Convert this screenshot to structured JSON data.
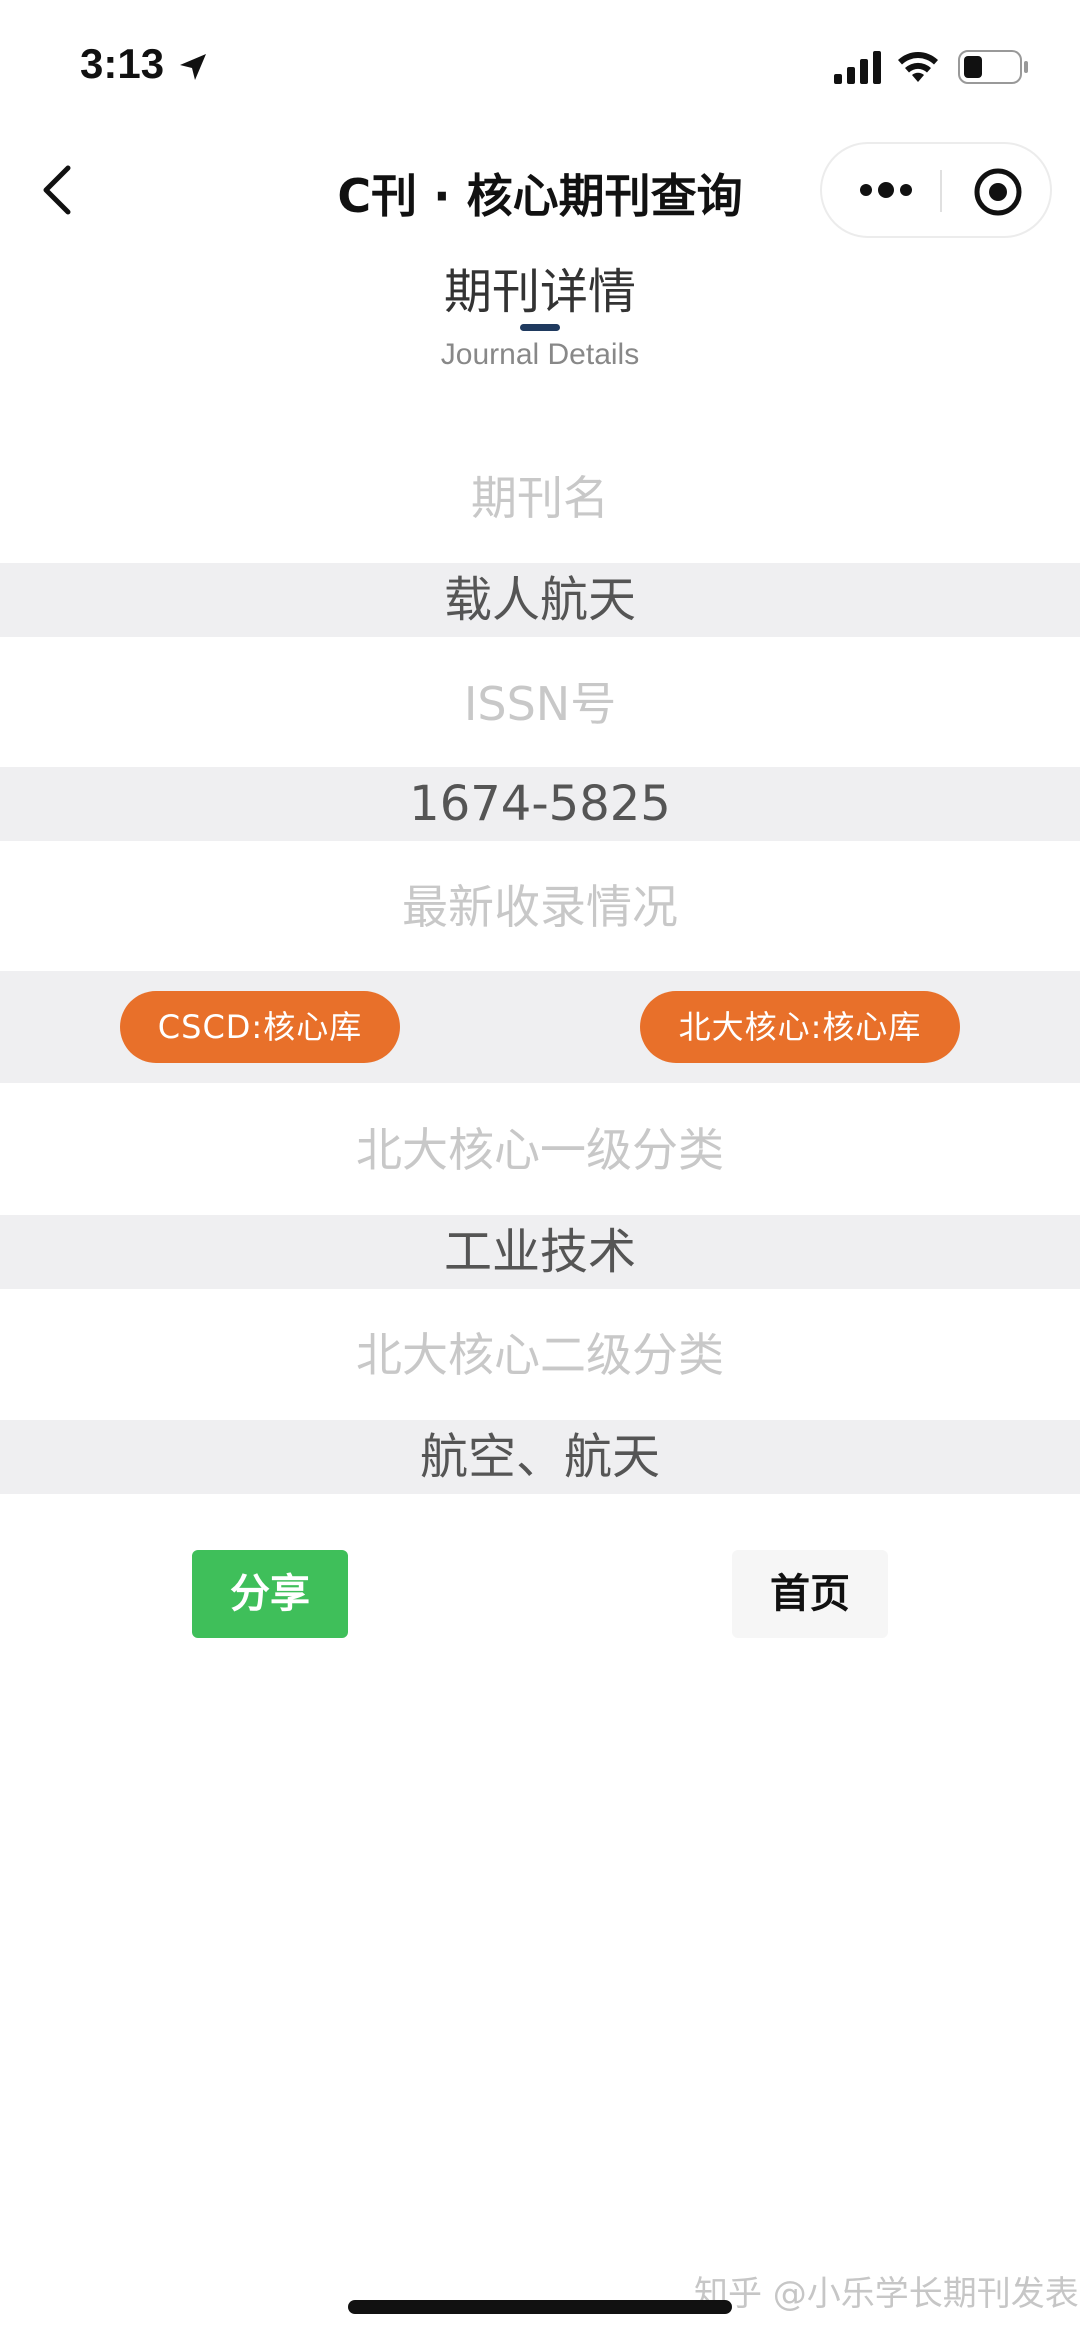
{
  "status_bar": {
    "time": "3:13"
  },
  "nav": {
    "title": "C刊 · 核心期刊查询"
  },
  "section": {
    "title": "期刊详情",
    "subtitle": "Journal Details"
  },
  "details": {
    "journal_name_label": "期刊名",
    "journal_name": "载人航天",
    "issn_label": "ISSN号",
    "issn": "1674-5825",
    "indexing_label": "最新收录情况",
    "indexing_tags": [
      "CSCD:核心库",
      "北大核心:核心库"
    ],
    "pku_level1_label": "北大核心一级分类",
    "pku_level1": "工业技术",
    "pku_level2_label": "北大核心二级分类",
    "pku_level2": "航空、航天"
  },
  "actions": {
    "share_label": "分享",
    "home_label": "首页"
  },
  "footer": {
    "watermark": "知乎 @小乐学长期刊发表"
  },
  "colors": {
    "tag": "#e8702a",
    "share": "#3fbf5a",
    "row_bg": "#efeff1",
    "underline": "#1f3a5f"
  }
}
